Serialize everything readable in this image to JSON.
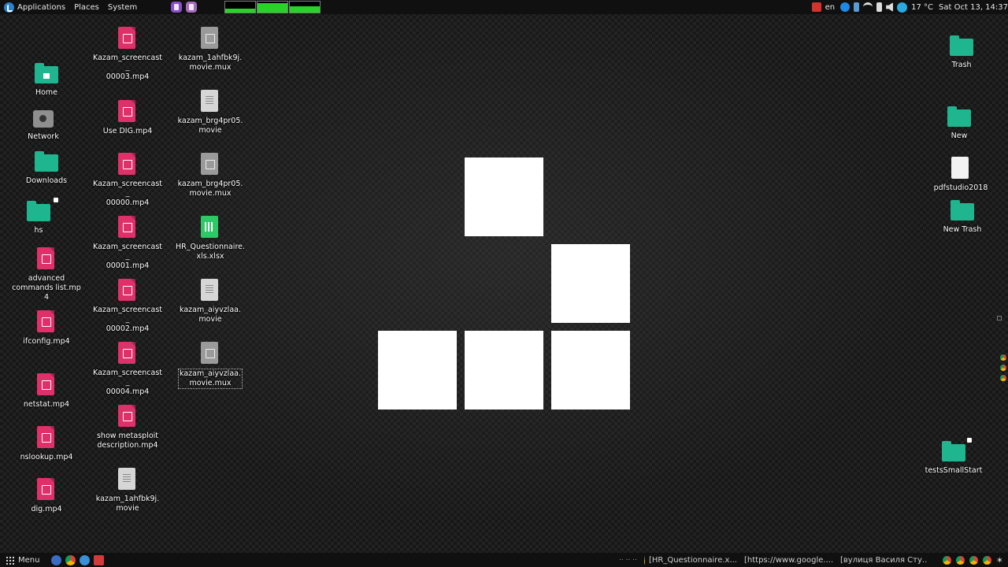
{
  "top_panel": {
    "menus": [
      "Applications",
      "Places",
      "System"
    ],
    "keyboard_layout": "en",
    "temperature": "17 °C",
    "clock": "Sat Oct 13, 14:37",
    "cpu_monitor_level": 0.35,
    "mem_monitor_level": 0.85,
    "net_monitor_level": 0.6
  },
  "desktop": {
    "col1": [
      "Home",
      "Network",
      "Downloads",
      "hs",
      "advanced\ncommands list.mp4",
      "ifconfig.mp4",
      "netstat.mp4",
      "nslookup.mp4",
      "dig.mp4"
    ],
    "col2": [
      "Kazam_screencast_\n00003.mp4",
      "Use DIG.mp4",
      "Kazam_screencast_\n00000.mp4",
      "Kazam_screencast_\n00001.mp4",
      "Kazam_screencast_\n00002.mp4",
      "Kazam_screencast_\n00004.mp4",
      "show metasploit\ndescription.mp4",
      "kazam_1ahfbk9j.\nmovie"
    ],
    "col3": [
      "kazam_1ahfbk9j.\nmovie.mux",
      "kazam_brg4pr05.\nmovie",
      "kazam_brg4pr05.\nmovie.mux",
      "HR_Questionnaire.\nxls.xlsx",
      "kazam_aiyvzlaa.\nmovie",
      "kazam_aiyvzlaa.\nmovie.mux"
    ],
    "right": [
      "Trash",
      "New",
      "pdfstudio2018",
      "New Trash",
      "testsSmallStart"
    ]
  },
  "bottom_panel": {
    "menu_label": "Menu",
    "dots": ".. .. ..",
    "tasks": [
      "[HR_Questionnaire.x...",
      "[https://www.google....",
      "[вулиця Василя Сту..."
    ]
  },
  "colors": {
    "folder": "#1fb58f",
    "video": "#e0306a",
    "panel": "#101010"
  }
}
